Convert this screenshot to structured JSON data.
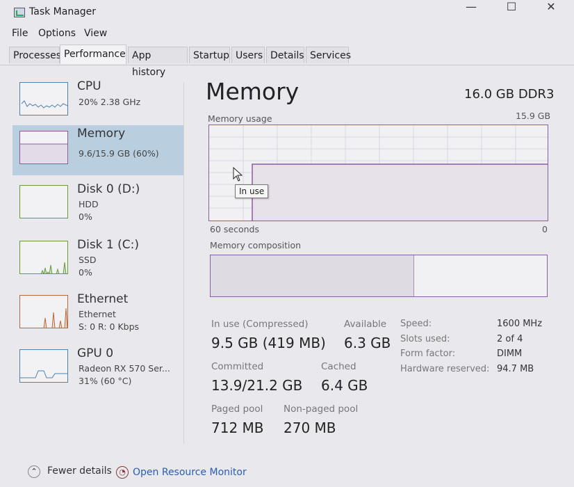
{
  "window": {
    "title": "Task Manager",
    "minimize": "—",
    "maximize": "☐",
    "close": "✕"
  },
  "menu": [
    "File",
    "Options",
    "View"
  ],
  "tabs": [
    "Processes",
    "Performance",
    "App history",
    "Startup",
    "Users",
    "Details",
    "Services"
  ],
  "sidebar": [
    {
      "title": "CPU",
      "lines": [
        "20%  2.38 GHz"
      ]
    },
    {
      "title": "Memory",
      "lines": [
        "9.6/15.9 GB (60%)"
      ]
    },
    {
      "title": "Disk 0 (D:)",
      "lines": [
        "HDD",
        "0%"
      ]
    },
    {
      "title": "Disk 1 (C:)",
      "lines": [
        "SSD",
        "0%"
      ]
    },
    {
      "title": "Ethernet",
      "lines": [
        "Ethernet",
        "S: 0  R: 0 Kbps"
      ]
    },
    {
      "title": "GPU 0",
      "lines": [
        "Radeon RX 570 Ser...",
        "31%  (60 °C)"
      ]
    }
  ],
  "main": {
    "heading": "Memory",
    "spec": "16.0 GB DDR3",
    "usage_label": "Memory usage",
    "usage_max": "15.9 GB",
    "x_left": "60 seconds",
    "x_right": "0",
    "tooltip": "In use",
    "composition_label": "Memory composition",
    "stats": {
      "in_use_label": "In use (Compressed)",
      "in_use_value": "9.5 GB (419 MB)",
      "available_label": "Available",
      "available_value": "6.3 GB",
      "committed_label": "Committed",
      "committed_value": "13.9/21.2 GB",
      "cached_label": "Cached",
      "cached_value": "6.4 GB",
      "paged_label": "Paged pool",
      "paged_value": "712 MB",
      "nonpaged_label": "Non-paged pool",
      "nonpaged_value": "270 MB"
    },
    "specs": [
      {
        "label": "Speed:",
        "value": "1600 MHz"
      },
      {
        "label": "Slots used:",
        "value": "2 of 4"
      },
      {
        "label": "Form factor:",
        "value": "DIMM"
      },
      {
        "label": "Hardware reserved:",
        "value": "94.7 MB"
      }
    ]
  },
  "footer": {
    "fewer_details": "Fewer details",
    "open_monitor": "Open Resource Monitor"
  },
  "colors": {
    "memory_accent": "#8b5c9e",
    "selected_bg": "#b9cfe0",
    "link": "#2a5db0"
  }
}
